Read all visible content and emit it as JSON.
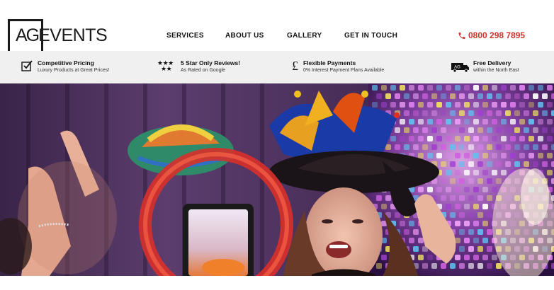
{
  "brand": {
    "logo_text": "AGEVENTS",
    "logo_ag": "AG",
    "logo_rest": "EVENTS"
  },
  "nav": {
    "items": [
      {
        "label": "SERVICES"
      },
      {
        "label": "ABOUT US"
      },
      {
        "label": "GALLERY"
      },
      {
        "label": "GET IN TOUCH"
      }
    ]
  },
  "phone": {
    "number": "0800 298 7895",
    "icon": "phone-icon",
    "color": "#d0342c"
  },
  "usps": [
    {
      "icon": "checkbox-icon",
      "title": "Competitive Pricing",
      "subtitle": "Luxury Products at Great Prices!"
    },
    {
      "icon": "stars-icon",
      "title": "5 Star Only Reviews!",
      "subtitle": "As Rated on Google"
    },
    {
      "icon": "pound-icon",
      "title": "Flexible Payments",
      "subtitle": "0% Interest Payment Plans Available"
    },
    {
      "icon": "delivery-truck-icon",
      "title": "Free Delivery",
      "subtitle": "within the North East",
      "badge": "AG"
    }
  ],
  "stars": {
    "row1": "★★★",
    "row2": "★★"
  },
  "pound_symbol": "£",
  "hero": {
    "image": "party-photo-booth-scene",
    "colors": {
      "background": "#2a1a3a",
      "curtain": "#5a3a6a",
      "ring_light": "#e0352a",
      "jester_hat": "#e05a1a",
      "sequin_wall": "#b060c0"
    }
  }
}
